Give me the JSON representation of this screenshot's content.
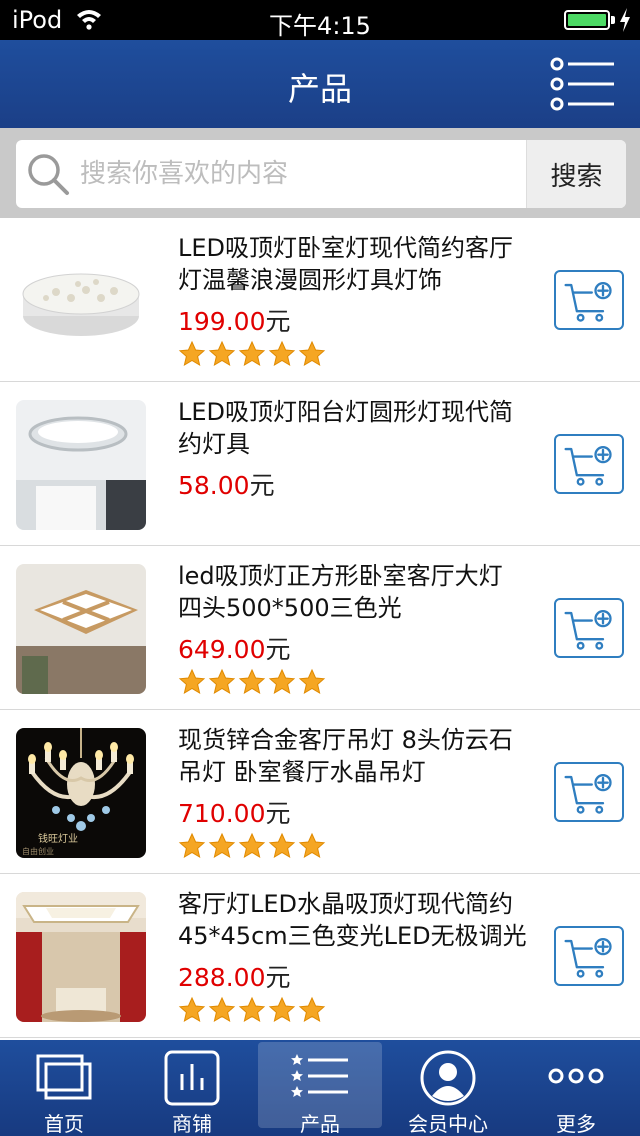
{
  "status_bar": {
    "carrier": "iPod",
    "time": "下午4:15",
    "battery_color": "#4cd964"
  },
  "nav": {
    "title": "产品",
    "menu_icon": "list-menu-icon"
  },
  "search": {
    "placeholder": "搜索你喜欢的内容",
    "button": "搜索"
  },
  "colors": {
    "brand_blue": "#1f4e9d",
    "price_red": "#e00000",
    "star_orange": "#f5a623",
    "cart_blue": "#2f7ec0"
  },
  "products": [
    {
      "name": "LED吸顶灯卧室灯现代简约客厅灯温馨浪漫圆形灯具灯饰",
      "price": "199.00",
      "unit": "元",
      "stars": 5
    },
    {
      "name": "LED吸顶灯阳台灯圆形灯现代简约灯具",
      "price": "58.00",
      "unit": "元",
      "stars": 0
    },
    {
      "name": "led吸顶灯正方形卧室客厅大灯 四头500*500三色光",
      "price": "649.00",
      "unit": "元",
      "stars": 5
    },
    {
      "name": "现货锌合金客厅吊灯 8头仿云石吊灯 卧室餐厅水晶吊灯",
      "price": "710.00",
      "unit": "元",
      "stars": 5,
      "thumb_text_1": "钱旺灯业",
      "thumb_text_2": "自由创业"
    },
    {
      "name": "客厅灯LED水晶吸顶灯现代简约45*45cm三色变光LED无极调光",
      "price": "288.00",
      "unit": "元",
      "stars": 5
    }
  ],
  "tabs": [
    {
      "label": "首页",
      "icon": "home-window-icon",
      "active": false
    },
    {
      "label": "商铺",
      "icon": "shop-chart-icon",
      "active": false
    },
    {
      "label": "产品",
      "icon": "product-list-icon",
      "active": true
    },
    {
      "label": "会员中心",
      "icon": "member-avatar-icon",
      "active": false
    },
    {
      "label": "更多",
      "icon": "more-dots-icon",
      "active": false
    }
  ]
}
